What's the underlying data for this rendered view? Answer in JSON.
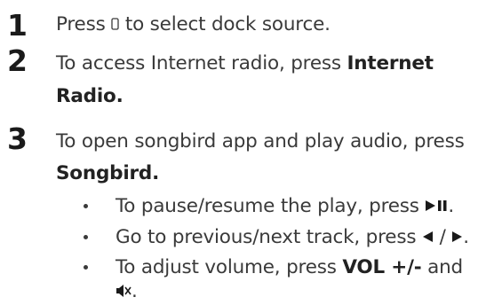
{
  "steps": [
    {
      "number": "1",
      "pre": "Press ",
      "post": " to select dock source."
    },
    {
      "number": "2",
      "text": "To access Internet radio, press ",
      "bold1": "Internet",
      "bold2": "Radio",
      "end": "."
    },
    {
      "number": "3",
      "text": "To open songbird app and play audio, press",
      "bold": "Songbird",
      "end": "."
    }
  ],
  "bullets": [
    {
      "text": "To pause/resume the play, press ",
      "end": "."
    },
    {
      "text": "Go to previous/next track, press ",
      "sep": " / ",
      "end": "."
    },
    {
      "pre": "To adjust volume, press ",
      "bold": "VOL +/-",
      "post": " and",
      "end": "."
    }
  ],
  "icons": [
    "dock-icon",
    "play-pause-icon",
    "previous-icon",
    "next-icon",
    "mute-icon"
  ]
}
